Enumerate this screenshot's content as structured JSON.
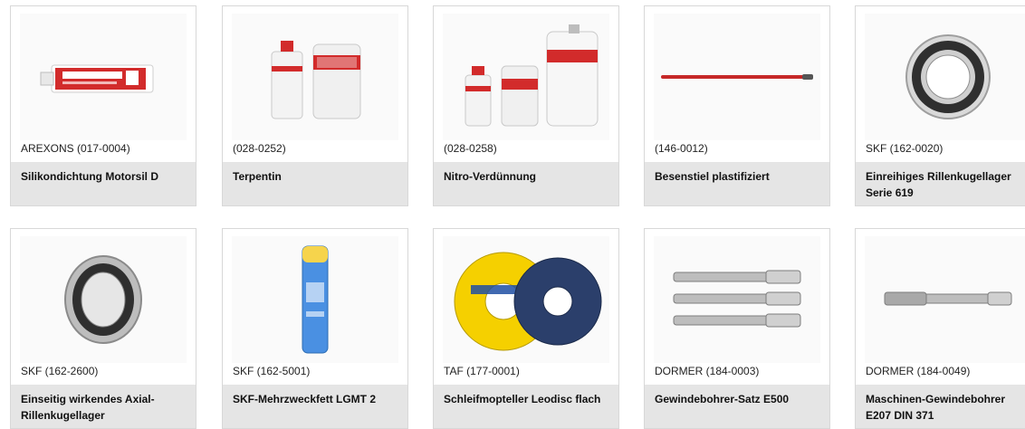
{
  "products": [
    {
      "sku": "AREXONS (017-0004)",
      "title": "Silikondichtung Motorsil D",
      "image": "sealant-tube-icon"
    },
    {
      "sku": "(028-0252)",
      "title": "Terpentin",
      "image": "paint-cans-icon"
    },
    {
      "sku": "(028-0258)",
      "title": "Nitro-Verdünnung",
      "image": "thinner-cans-icon"
    },
    {
      "sku": "(146-0012)",
      "title": "Besenstiel plastifiziert",
      "image": "broom-handle-icon"
    },
    {
      "sku": "SKF (162-0020)",
      "title": "Einreihiges Rillenkugellager Serie 619",
      "image": "ball-bearing-icon"
    },
    {
      "sku": "SKF (162-2600)",
      "title": "Einseitig wirkendes Axial-Rillenkugellager",
      "image": "thrust-bearing-icon"
    },
    {
      "sku": "SKF (162-5001)",
      "title": "SKF-Mehrzweckfett LGMT 2",
      "image": "grease-cartridge-icon"
    },
    {
      "sku": "TAF (177-0001)",
      "title": "Schleifmopteller Leodisc flach",
      "image": "flap-disc-icon"
    },
    {
      "sku": "DORMER (184-0003)",
      "title": "Gewindebohrer-Satz E500",
      "image": "tap-set-icon"
    },
    {
      "sku": "DORMER (184-0049)",
      "title": "Maschinen-Gewindebohrer E207 DIN 371",
      "image": "machine-tap-icon"
    }
  ],
  "colors": {
    "title_bar": "#e5e5e5",
    "border": "#d8d8d8"
  }
}
